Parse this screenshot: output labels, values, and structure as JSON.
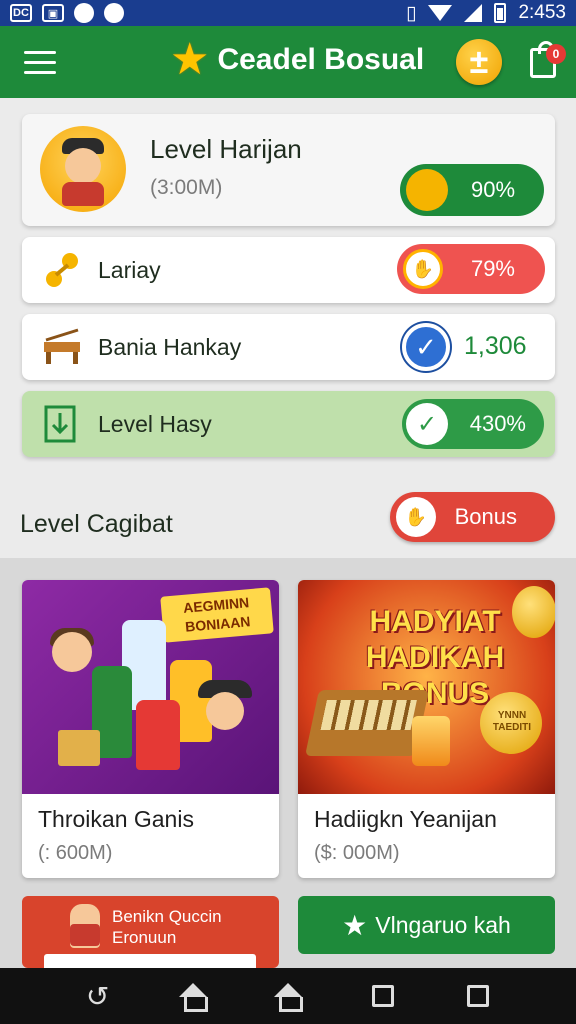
{
  "status_bar": {
    "time": "2:453",
    "left_icons": [
      "DC"
    ]
  },
  "header": {
    "title": "Ceadel Bosual",
    "cart_badge": "0"
  },
  "top_card": {
    "title": "Level Harijan",
    "subtitle": "(3:00M)",
    "progress": "90%"
  },
  "rows": [
    {
      "label": "Lariay",
      "value": "79%"
    },
    {
      "label": "Bania Hankay",
      "value": "1,306"
    },
    {
      "label": "Level  Hasy",
      "value": "430%"
    }
  ],
  "section": {
    "title": "Level Cagibat",
    "bonus_label": "Bonus"
  },
  "products": [
    {
      "name": "Throikan Ganis",
      "price": "(: 600M)",
      "banner": "AEGMINN BONIAAN"
    },
    {
      "name": "Hadiigkn Yeanijan",
      "price": "($: 000M)",
      "headline": "HADYIAT HADIKAH BONUS",
      "coin_text": "YNNN TAEDITI"
    }
  ],
  "actions": {
    "left_label": "Benikn Quccin Eronuun",
    "right_label": "Vlngaruo kah"
  },
  "colors": {
    "primary_green": "#1e8a3a",
    "accent_red": "#e0453a",
    "accent_gold": "#f5b400"
  }
}
